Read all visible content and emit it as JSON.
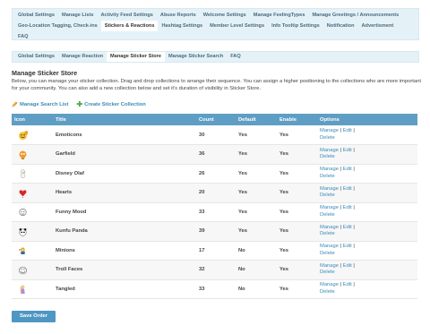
{
  "top_tabs": {
    "row1": [
      "Global Settings",
      "Manage Lists",
      "Activity Feed Settings",
      "Abuse Reports",
      "Welcome Settings",
      "Manage FeelingTypes",
      "Manage Greetings / Announcements"
    ],
    "row2": [
      "Geo-Location Tagging, Check-ins",
      "Stickers & Reactions",
      "Hashtag Settings",
      "Member Level Settings",
      "Info Tooltip Settings",
      "Notification",
      "Advertisment"
    ],
    "row3": [
      "FAQ"
    ],
    "active": "Stickers & Reactions"
  },
  "sub_tabs": {
    "items": [
      "Global Settings",
      "Manage Reaction",
      "Manage Sticker Store",
      "Manage Sticker Search",
      "FAQ"
    ],
    "active": "Manage Sticker Store"
  },
  "page": {
    "title": "Manage Sticker Store",
    "description": "Below, you can manage your sticker collection. Drag and drop collections to arrange their sequence. You can assign a higher positioning to the collections who are more important for your community. You can also add a new collection below and set it's duration of visibility in Sticker Store."
  },
  "actions": {
    "manage_search_list": "Manage Search List",
    "create_collection": "Create Sticker Collection"
  },
  "table": {
    "headers": {
      "icon": "Icon",
      "title": "Title",
      "count": "Count",
      "default": "Default",
      "enable": "Enable",
      "options": "Options"
    },
    "option_labels": {
      "manage": "Manage",
      "edit": "Edit",
      "delete": "Delete",
      "sep": "|"
    },
    "rows": [
      {
        "icon": "emoticon-sticker-icon",
        "title": "Emoticons",
        "count": "30",
        "default": "Yes",
        "enable": "Yes"
      },
      {
        "icon": "garfield-sticker-icon",
        "title": "Garfield",
        "count": "36",
        "default": "Yes",
        "enable": "Yes"
      },
      {
        "icon": "olaf-sticker-icon",
        "title": "Disney Olaf",
        "count": "26",
        "default": "Yes",
        "enable": "Yes"
      },
      {
        "icon": "heart-sticker-icon",
        "title": "Hearts",
        "count": "20",
        "default": "Yes",
        "enable": "Yes"
      },
      {
        "icon": "funny-mood-sticker-icon",
        "title": "Funny Mood",
        "count": "33",
        "default": "Yes",
        "enable": "Yes"
      },
      {
        "icon": "kunfu-panda-sticker-icon",
        "title": "Kunfu Panda",
        "count": "39",
        "default": "Yes",
        "enable": "Yes"
      },
      {
        "icon": "minions-sticker-icon",
        "title": "Minions",
        "count": "17",
        "default": "No",
        "enable": "Yes"
      },
      {
        "icon": "troll-face-sticker-icon",
        "title": "Troll Faces",
        "count": "32",
        "default": "No",
        "enable": "Yes"
      },
      {
        "icon": "tangled-sticker-icon",
        "title": "Tangled",
        "count": "33",
        "default": "No",
        "enable": "Yes"
      }
    ]
  },
  "save_button": "Save Order",
  "colors": {
    "tab_bg": "#e4f2f8",
    "header_bg": "#5f9ec4",
    "link": "#3a8bb7",
    "button": "#4f97c3"
  }
}
